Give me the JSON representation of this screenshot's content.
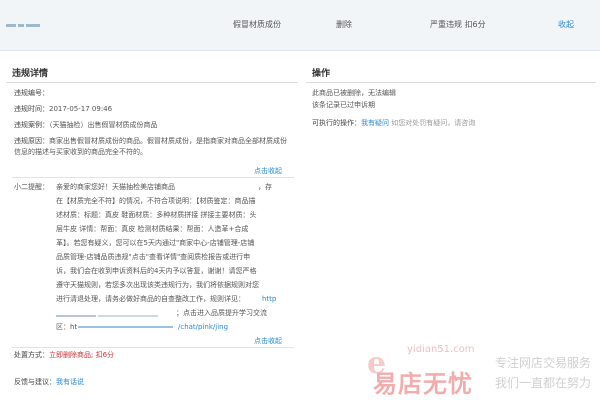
{
  "topbar": {
    "item": "假冒材质成份",
    "status": "删除",
    "severity": "严重违规 扣6分",
    "collapse": "收起"
  },
  "left": {
    "title": "违规详情",
    "rows": [
      {
        "label": "违规编号：",
        "value": ""
      },
      {
        "label": "违规时间：",
        "value": "2017-05-17 09:46"
      },
      {
        "label": "违规案例：",
        "value": "（天猫抽检）出售假冒材质成份商品"
      },
      {
        "label": "违规原因：",
        "value": "商家出售假冒材质成份的商品。假冒材质成份，是指商家对商品全部材质成份信息的描述与买家收到的商品完全不符的。"
      }
    ],
    "collapse_link_1": "点击收起",
    "tip_label": "小二提醒：",
    "tip_lines": [
      "亲爱的商家您好！天猫抽检美店铺商品",
      "，存",
      "在【材质完全不符】的情况，不符合项说明：【材质鉴定：商品描",
      "述材质：标题：真皮 鞋面材质：多种材质拼接 拼接主要材质：头",
      "层牛皮 详情：帮面：真皮 检测材质结果：帮面：人造革+合成",
      "革】。若您有疑义，您可以在5天内通过\"商家中心-店铺管理-店铺",
      "品质管理-店铺品质违规\"点击\"查看详情\"查阅质检报告或进行申",
      "诉，我们会在收到申诉资料后的4天内予以答复，谢谢！请您严格",
      "遵守天猫规则，若您多次出现该类违规行为，我们将依据规则对您",
      "进行清退处理，请务必做好商品的自查整改工作，规则详见：",
      "；点击进入品质提升学习交流",
      "区：ht"
    ],
    "tip_url_1": "http",
    "tip_url_2": "/chat/pink/jing",
    "collapse_link_2": "点击收起",
    "handling_label": "处置方式：",
    "handling_value": "立即删除商品; 扣6分",
    "feedback_label": "反馈与建议：",
    "feedback_link": "我有话说"
  },
  "right": {
    "title": "操作",
    "line1": "此商品已被删除，无法编辑",
    "line2": "该条记录已过申诉期",
    "ops_label": "可执行的操作：",
    "ops_link": "我有疑问",
    "ops_hint": "如您对处罚有疑问，请咨询"
  },
  "watermark": {
    "url": "yidian51.com",
    "brand": "易店无忧",
    "slogan1": "专注网店交易服务",
    "slogan2": "我们一直都在努力"
  }
}
